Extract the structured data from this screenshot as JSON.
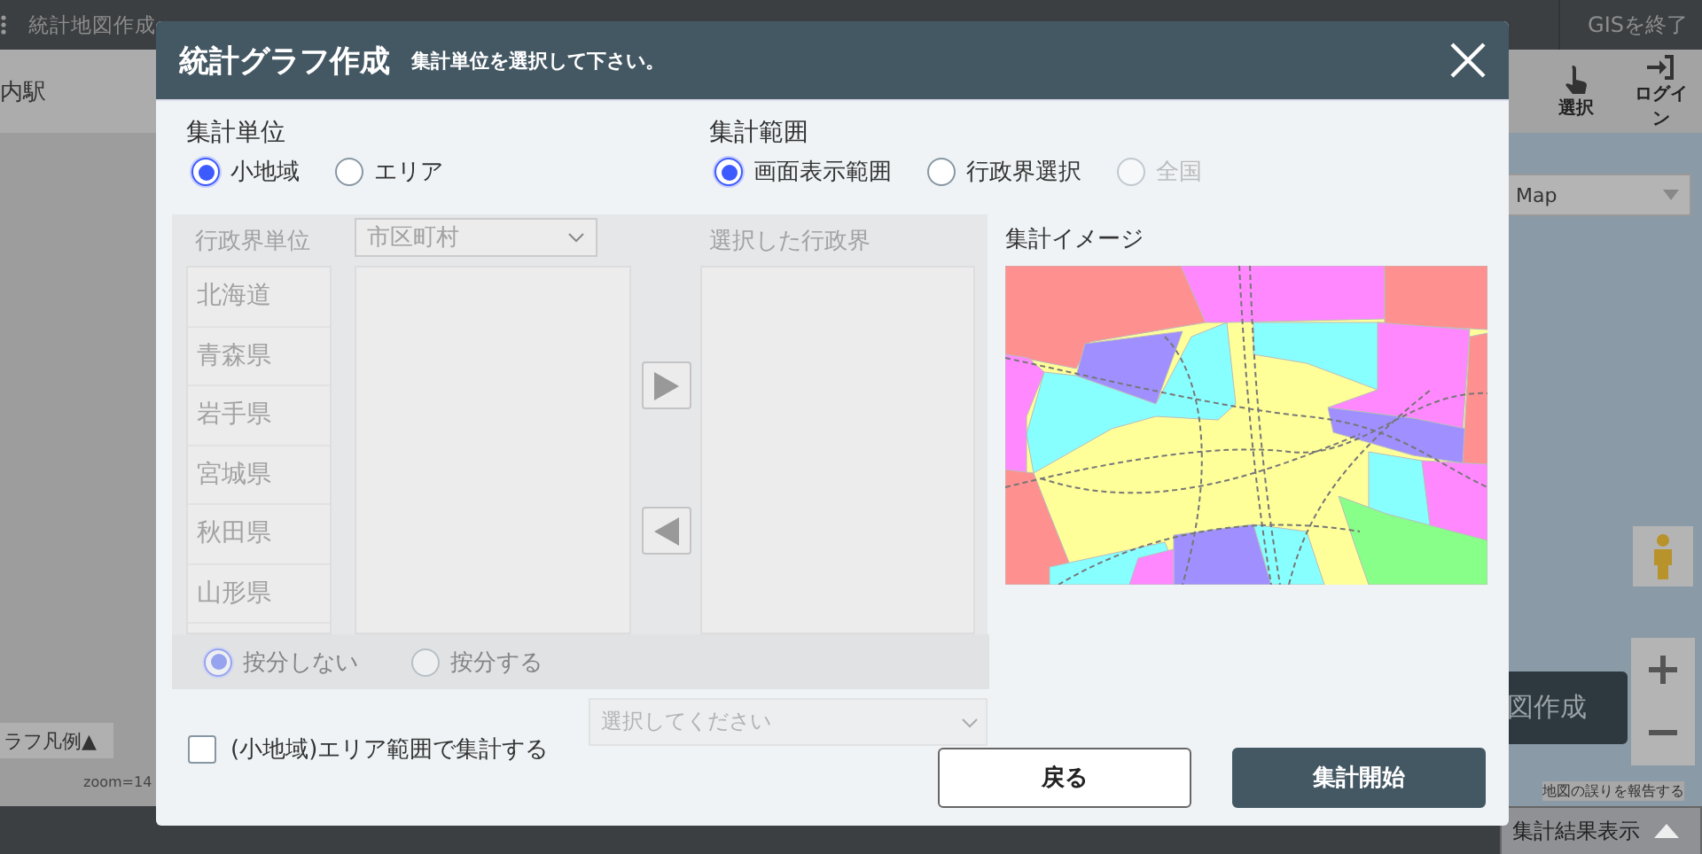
{
  "app_bar": {
    "menu_items": [
      "統計地図作成"
    ],
    "exit_button": "GISを終了"
  },
  "toolbar": {
    "search_value": "内駅",
    "tools": [
      {
        "label": "選択",
        "kind": "select"
      },
      {
        "label": "ログイン",
        "kind": "login"
      }
    ]
  },
  "map": {
    "type_select": "Map",
    "graph_button": "図作成",
    "legend_toggle": "ラフ凡例▲",
    "zoom_label": "zoom=14",
    "report_link": "地図の誤りを報告する",
    "results_toggle": "集計結果表示"
  },
  "dialog": {
    "title": "統計グラフ作成",
    "subtitle": "集計単位を選択して下さい。",
    "unit": {
      "label": "集計単位",
      "options": [
        {
          "label": "小地域",
          "selected": true,
          "disabled": false
        },
        {
          "label": "エリア",
          "selected": false,
          "disabled": false
        }
      ]
    },
    "range": {
      "label": "集計範囲",
      "options": [
        {
          "label": "画面表示範囲",
          "selected": true,
          "disabled": false
        },
        {
          "label": "行政界選択",
          "selected": false,
          "disabled": false
        },
        {
          "label": "全国",
          "selected": false,
          "disabled": true
        }
      ]
    },
    "boundary_panel": {
      "disabled": true,
      "unit_label": "行政界単位",
      "unit_select": "市区町村",
      "prefectures": [
        "北海道",
        "青森県",
        "岩手県",
        "宮城県",
        "秋田県",
        "山形県"
      ],
      "selected_label": "選択した行政界",
      "apportion": [
        {
          "label": "按分しない",
          "selected": true
        },
        {
          "label": "按分する",
          "selected": false
        }
      ]
    },
    "area_select": {
      "placeholder": "選択してください",
      "disabled": true
    },
    "area_checkbox": {
      "label": "(小地域)エリア範囲で集計する",
      "checked": false
    },
    "preview_label": "集計イメージ",
    "buttons": [
      {
        "label": "戻る",
        "kind": "secondary"
      },
      {
        "label": "集計開始",
        "kind": "primary"
      }
    ]
  }
}
